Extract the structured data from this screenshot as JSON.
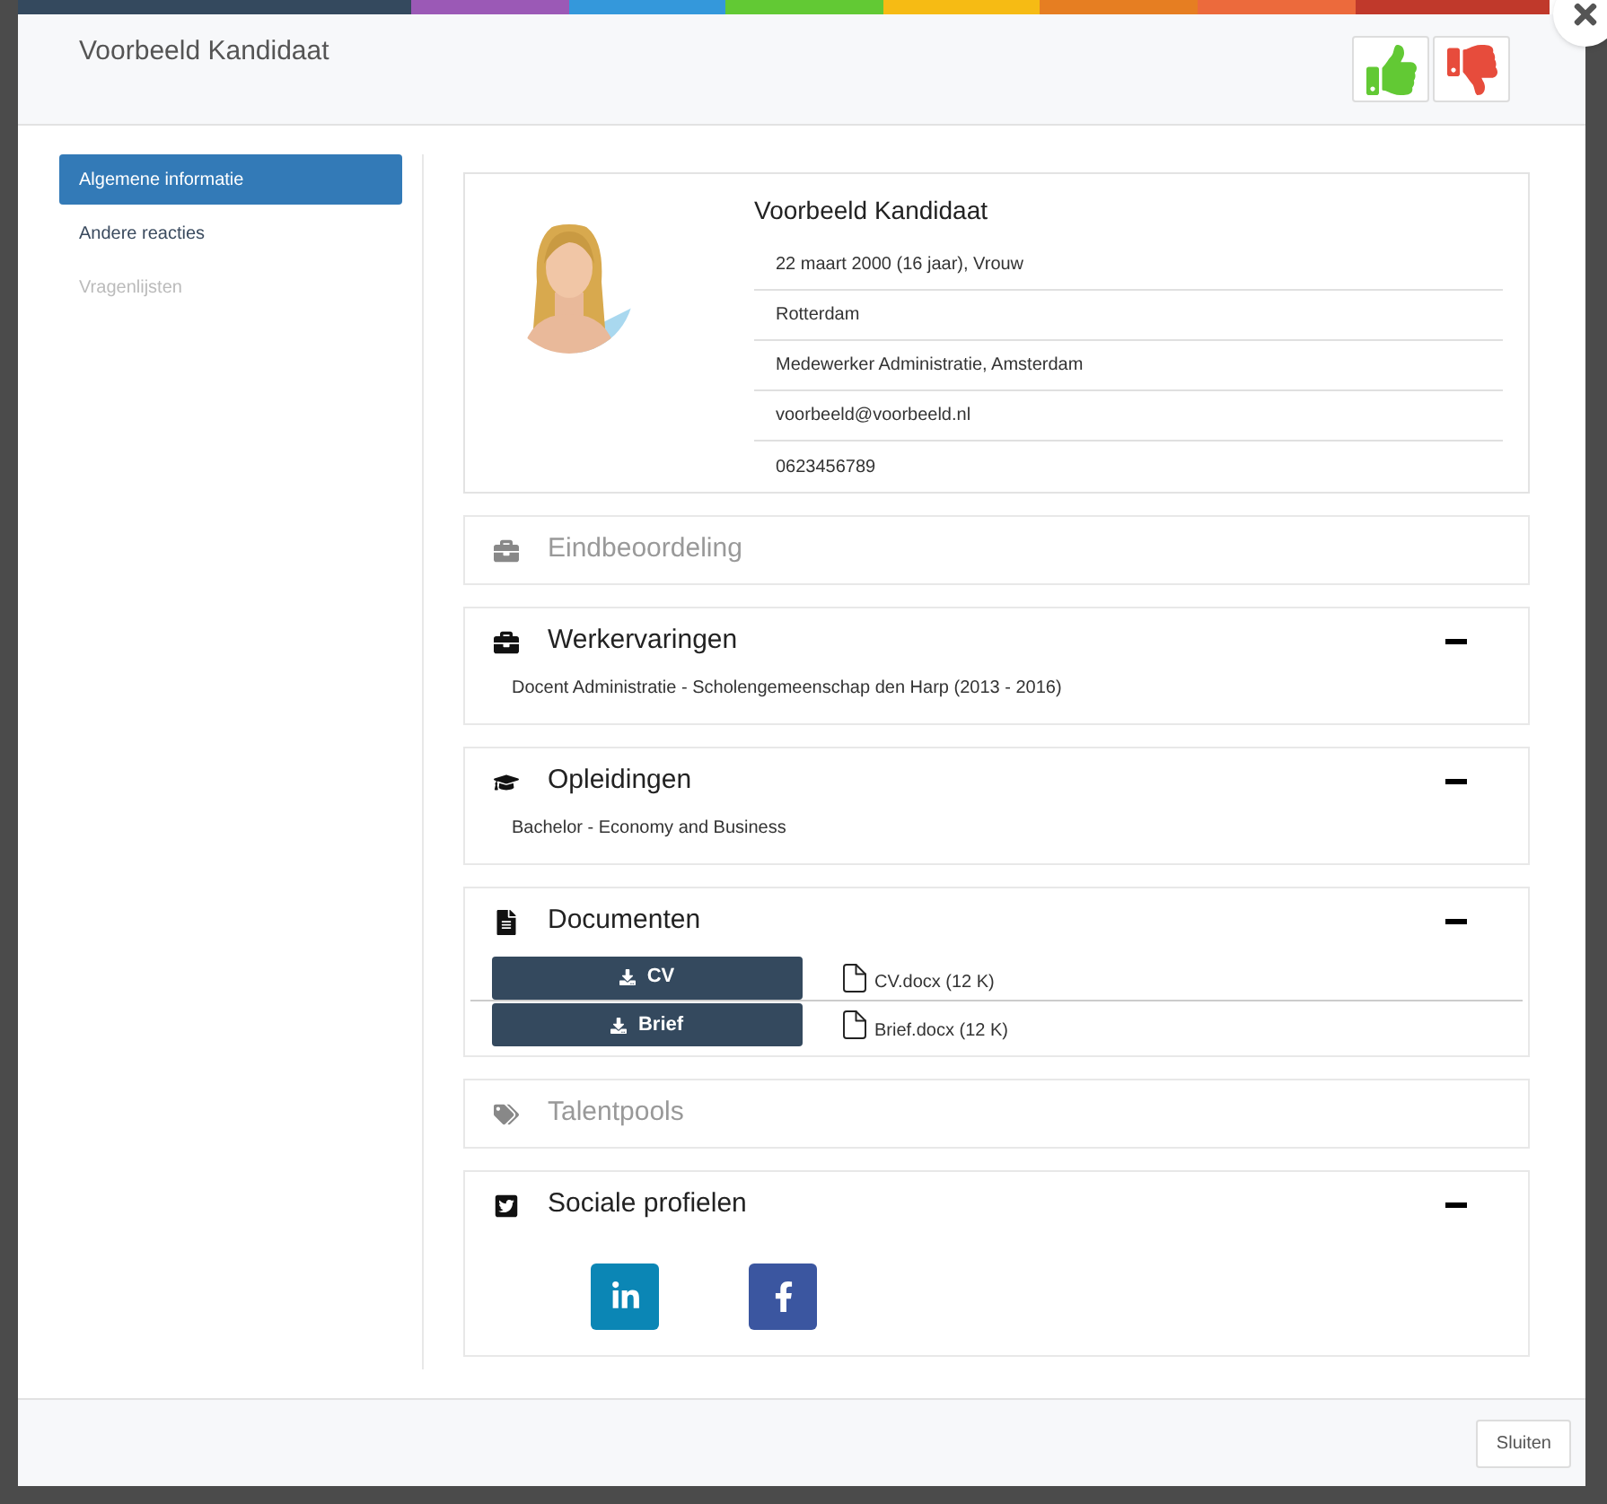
{
  "modal": {
    "title": "Voorbeeld Kandidaat"
  },
  "sidebar": {
    "items": [
      {
        "label": "Algemene informatie",
        "selected": true,
        "disabled": false
      },
      {
        "label": "Andere reacties",
        "selected": false,
        "disabled": false
      },
      {
        "label": "Vragenlijsten",
        "selected": false,
        "disabled": true
      }
    ]
  },
  "profile": {
    "name": "Voorbeeld Kandidaat",
    "details": [
      "22 maart 2000 (16 jaar), Vrouw",
      "Rotterdam",
      "Medewerker Administratie, Amsterdam",
      "voorbeeld@voorbeeld.nl",
      "0623456789"
    ]
  },
  "sections": [
    {
      "kind": "rating",
      "title": "Eindbeoordeling",
      "disabled": true,
      "expanded": false
    },
    {
      "kind": "experience",
      "title": "Werkervaringen",
      "disabled": false,
      "expanded": true,
      "lines": [
        "Docent Administratie - Scholengemeenschap den Harp (2013 - 2016)"
      ]
    },
    {
      "kind": "education",
      "title": "Opleidingen",
      "disabled": false,
      "expanded": true,
      "lines": [
        "Bachelor - Economy and Business"
      ]
    },
    {
      "kind": "documents",
      "title": "Documenten",
      "disabled": false,
      "expanded": true,
      "documents": [
        {
          "button": "CV",
          "file": "CV.docx (12 K)"
        },
        {
          "button": "Brief",
          "file": "Brief.docx (12 K)"
        }
      ]
    },
    {
      "kind": "tags",
      "title": "Talentpools",
      "disabled": true,
      "expanded": false
    },
    {
      "kind": "social",
      "title": "Sociale profielen",
      "disabled": false,
      "expanded": true,
      "profiles": [
        {
          "kind": "linkedin"
        },
        {
          "kind": "facebook"
        }
      ]
    }
  ],
  "footer": {
    "close_button": "Sluiten"
  }
}
